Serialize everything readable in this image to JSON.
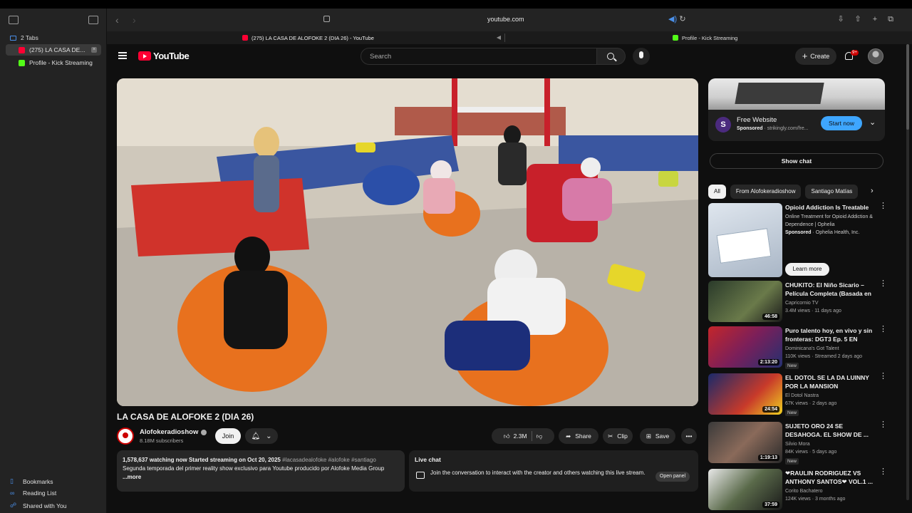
{
  "browser": {
    "url": "youtube.com",
    "tab_group_label": "2 Tabs",
    "sidebar_tabs": [
      {
        "label": "(275) LA CASA DE..."
      },
      {
        "label": "Profile - Kick Streaming"
      }
    ],
    "tabs": [
      {
        "label": "(275) LA CASA DE ALOFOKE 2 (DIA 26) - YouTube"
      },
      {
        "label": "Profile - Kick Streaming"
      }
    ],
    "sidebar_bottom": [
      {
        "label": "Bookmarks",
        "icon": "book-icon"
      },
      {
        "label": "Reading List",
        "icon": "glasses-icon"
      },
      {
        "label": "Shared with You",
        "icon": "people-icon"
      }
    ]
  },
  "header": {
    "logo_text": "YouTube",
    "search_placeholder": "Search",
    "create_label": "Create",
    "notification_badge": "9+"
  },
  "video": {
    "title": "LA CASA DE ALOFOKE 2 (DIA 26)",
    "channel_name": "Alofokeradioshow",
    "subscribers": "8.18M subscribers",
    "join_label": "Join",
    "likes": "2.3M",
    "share_label": "Share",
    "clip_label": "Clip",
    "save_label": "Save",
    "watching": "1,578,637 watching now",
    "streaming_since": "Started streaming on Oct 20, 2025",
    "hashtags": "#lacasadealofoke #alofoke #santiago",
    "description": "Segunda temporada del primer reality show exclusivo para Youtube producido por Alofoke Media Group",
    "more_label": "...more"
  },
  "live_chat": {
    "title": "Live chat",
    "text": "Join the conversation to interact with the creator and others watching this live stream.",
    "open_panel_label": "Open panel"
  },
  "ad": {
    "title": "Free Website",
    "sponsored": "Sponsored",
    "domain": "· strikingly.com/fre...",
    "cta": "Start now",
    "logo_letter": "S"
  },
  "show_chat_label": "Show chat",
  "chips": [
    {
      "label": "All"
    },
    {
      "label": "From Alofokeradioshow"
    },
    {
      "label": "Santiago Matías"
    }
  ],
  "recommendations": [
    {
      "title": "Opioid Addiction Is Treatable",
      "line1": "Online Treatment for Opioid Addiction & Dependence | Ophelia",
      "sponsored": "Sponsored",
      "advertiser": "· Ophelia Health, Inc.",
      "cta": "Learn more"
    },
    {
      "title": "CHUKITO: El Niño Sicario – Película Completa (Basada en ...",
      "channel": "Capricornio TV",
      "meta": "3.4M views · 11 days ago",
      "duration": "46:58"
    },
    {
      "title": "Puro talento hoy, en vivo y sin fronteras: DGT3 Ep. 5 EN VIVO...",
      "channel": "Dominicana's Got Talent",
      "meta": "110K views · Streamed 2 days ago",
      "duration": "2:13:20",
      "badge": "New"
    },
    {
      "title": "EL DOTOL SE LA DA LUINNY POR LA MANSION",
      "channel": "El Dotol Nastra",
      "meta": "67K views · 2 days ago",
      "duration": "24:54",
      "badge": "New"
    },
    {
      "title": "SUJETO ORO 24 SE DESAHOGA. EL SHOW DE ...",
      "channel": "Silvio Mora",
      "meta": "84K views · 5 days ago",
      "duration": "1:19:13",
      "badge": "New"
    },
    {
      "title": "❤RAULIN RODRIGUEZ VS ANTHONY SANTOS❤ VOL.1 ...",
      "channel": "Corito Bachatero",
      "meta": "124K views · 3 months ago",
      "duration": "37:59"
    }
  ]
}
